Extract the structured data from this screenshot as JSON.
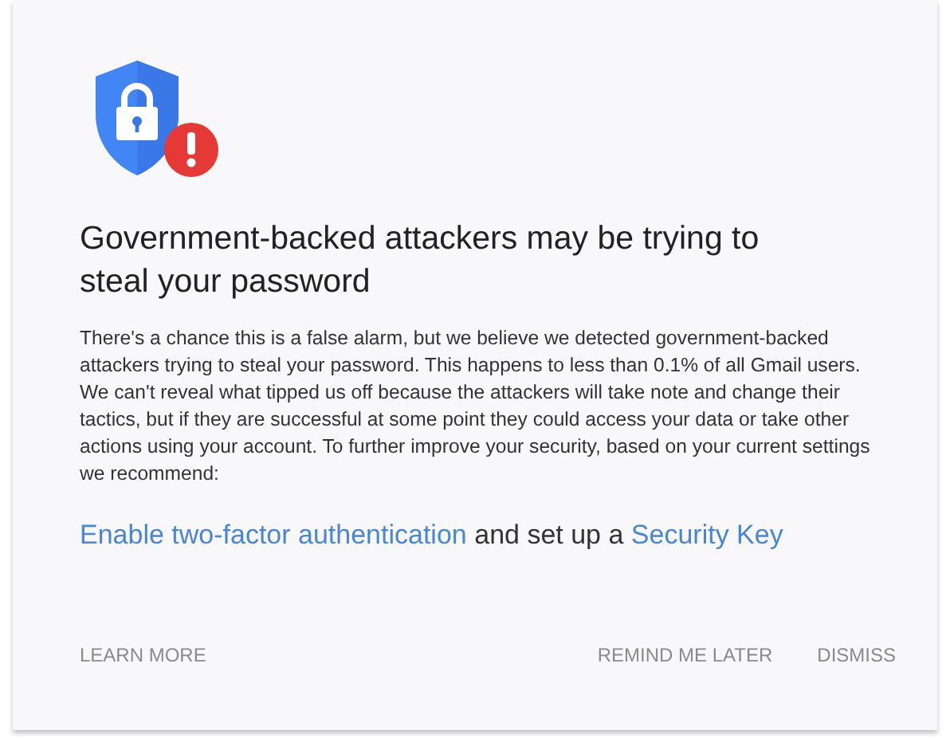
{
  "heading": "Government-backed attackers may be trying to steal your password",
  "body": "There's a chance this is a false alarm, but we believe we detected government-backed attackers trying to steal your password. This happens to less than 0.1% of all Gmail users. We can't reveal what tipped us off because the attackers will take note and change their tactics, but if they are successful at some point they could access your data or take other actions using your account. To further improve your security, based on your current settings we recommend:",
  "recommendation": [
    {
      "kind": "link",
      "text": "Enable two-factor authentication"
    },
    {
      "kind": "text",
      "text": "and set up a"
    },
    {
      "kind": "link",
      "text": "Security Key"
    }
  ],
  "actions_left": [
    "LEARN MORE"
  ],
  "actions_right": [
    "REMIND ME LATER",
    "DISMISS"
  ]
}
